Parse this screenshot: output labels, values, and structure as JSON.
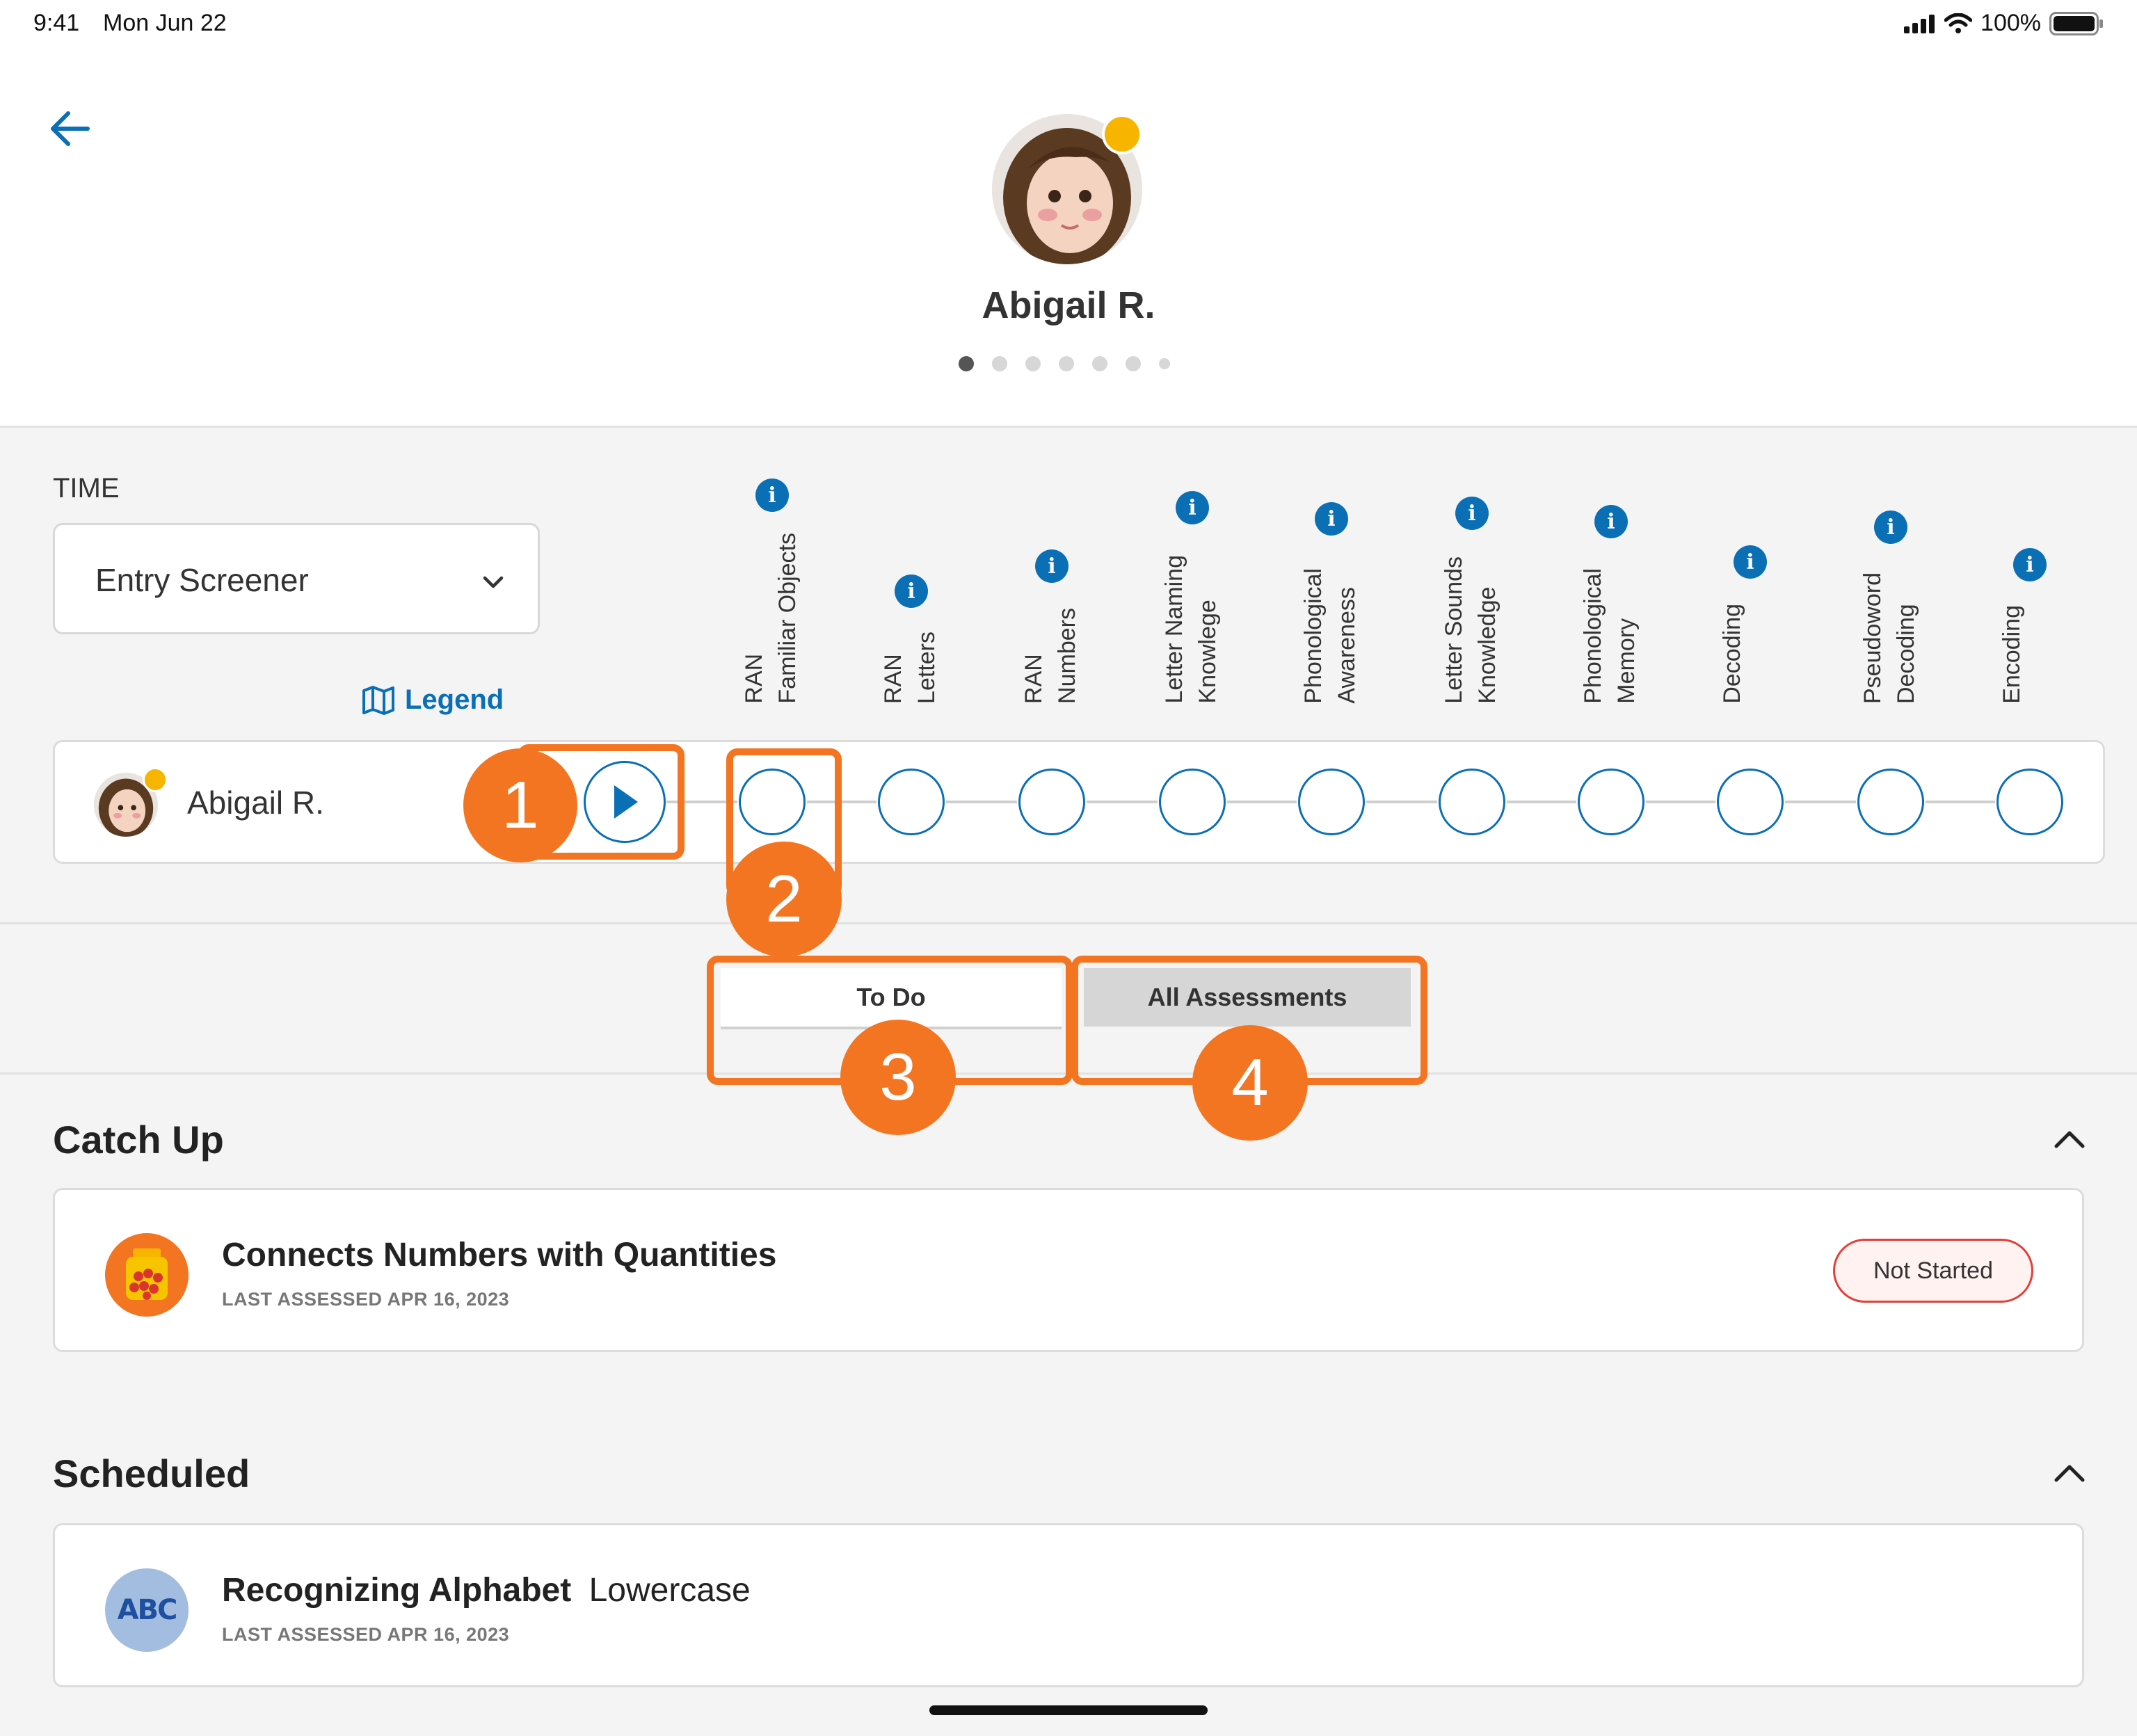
{
  "status_bar": {
    "time": "9:41",
    "date": "Mon Jun 22",
    "battery": "100%"
  },
  "student": {
    "name": "Abigail R."
  },
  "time_section": {
    "label": "TIME",
    "selected": "Entry Screener",
    "legend_label": "Legend"
  },
  "columns": [
    {
      "line1": "RAN",
      "line2": "Familiar Objects"
    },
    {
      "line1": "RAN",
      "line2": "Letters"
    },
    {
      "line1": "RAN",
      "line2": "Numbers"
    },
    {
      "line1": "Letter Naming",
      "line2": "Knowlege"
    },
    {
      "line1": "Phonological",
      "line2": "Awareness"
    },
    {
      "line1": "Letter Sounds",
      "line2": "Knowledge"
    },
    {
      "line1": "Phonological",
      "line2": "Memory"
    },
    {
      "line1": "Decoding",
      "line2": ""
    },
    {
      "line1": "Pseudoword",
      "line2": "Decoding"
    },
    {
      "line1": "Encoding",
      "line2": ""
    }
  ],
  "annotations": [
    "1",
    "2",
    "3",
    "4"
  ],
  "tabs": {
    "todo": "To Do",
    "all": "All Assessments"
  },
  "catch_up": {
    "title": "Catch Up",
    "item_title": "Connects Numbers with Quantities",
    "item_sub": "LAST ASSESSED APR 16, 2023",
    "status": "Not Started"
  },
  "scheduled": {
    "title": "Scheduled",
    "item_title": "Recognizing Alphabet",
    "item_title_extra": "Lowercase",
    "item_sub": "LAST ASSESSED APR 16, 2023",
    "icon_text": "ABC"
  },
  "colors": {
    "accent": "#0a6fb5",
    "annotation": "#f37521",
    "status_dot": "#f7b500",
    "badge_border": "#e0413a"
  }
}
